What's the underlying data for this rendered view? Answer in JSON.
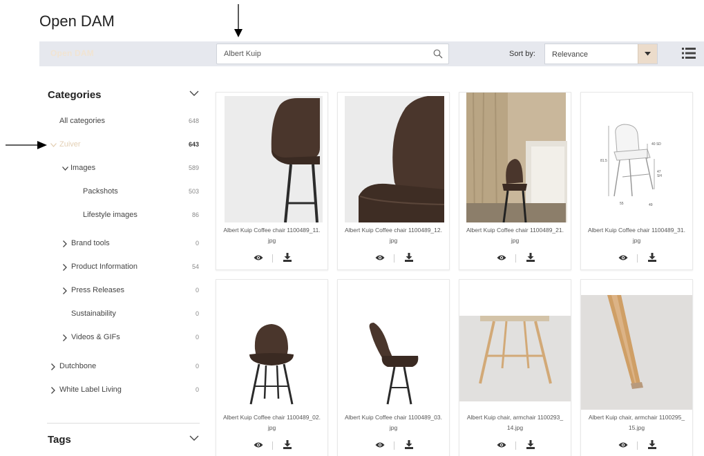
{
  "page_title": "Open DAM",
  "topbar": {
    "brand": "Open DAM",
    "search_value": "Albert Kuip",
    "sort_label": "Sort by:",
    "sort_value": "Relevance"
  },
  "sidebar": {
    "categories_title": "Categories",
    "tags_title": "Tags",
    "items": [
      {
        "label": "All categories",
        "count": "648"
      },
      {
        "label": "Zuiver",
        "count": "643"
      },
      {
        "label": "Images",
        "count": "589"
      },
      {
        "label": "Packshots",
        "count": "503"
      },
      {
        "label": "Lifestyle images",
        "count": "86"
      },
      {
        "label": "Brand tools",
        "count": "0"
      },
      {
        "label": "Product Information",
        "count": "54"
      },
      {
        "label": "Press Releases",
        "count": "0"
      },
      {
        "label": "Sustainability",
        "count": "0"
      },
      {
        "label": "Videos & GIFs",
        "count": "0"
      },
      {
        "label": "Dutchbone",
        "count": "0"
      },
      {
        "label": "White Label Living",
        "count": "0"
      }
    ]
  },
  "assets": [
    {
      "line1": "Albert Kuip Coffee chair 1100489_11.",
      "line2": "jpg"
    },
    {
      "line1": "Albert Kuip Coffee chair 1100489_12.",
      "line2": "jpg"
    },
    {
      "line1": "Albert Kuip Coffee chair 1100489_21.",
      "line2": "jpg"
    },
    {
      "line1": "Albert Kuip Coffee chair 1100489_31.",
      "line2": "jpg"
    },
    {
      "line1": "Albert Kuip Coffee chair 1100489_02.",
      "line2": "jpg"
    },
    {
      "line1": "Albert Kuip Coffee chair 1100489_03.",
      "line2": "jpg"
    },
    {
      "line1": "Albert Kuip chair, armchair 1100293_",
      "line2": "14.jpg"
    },
    {
      "line1": "Albert Kuip chair, armchair 1100295_",
      "line2": "15.jpg"
    }
  ],
  "diagram_labels": [
    "40 SD",
    "81.5",
    "47",
    "SH",
    "55",
    "49"
  ],
  "colors": {
    "accent": "#e3cfb4",
    "topbar": "#e6e8ee",
    "chair_brown": "#4a362c"
  },
  "icons": [
    "search-icon",
    "chevron-down-icon",
    "list-view-icon",
    "eye-icon",
    "download-icon",
    "chevron-right-icon"
  ]
}
